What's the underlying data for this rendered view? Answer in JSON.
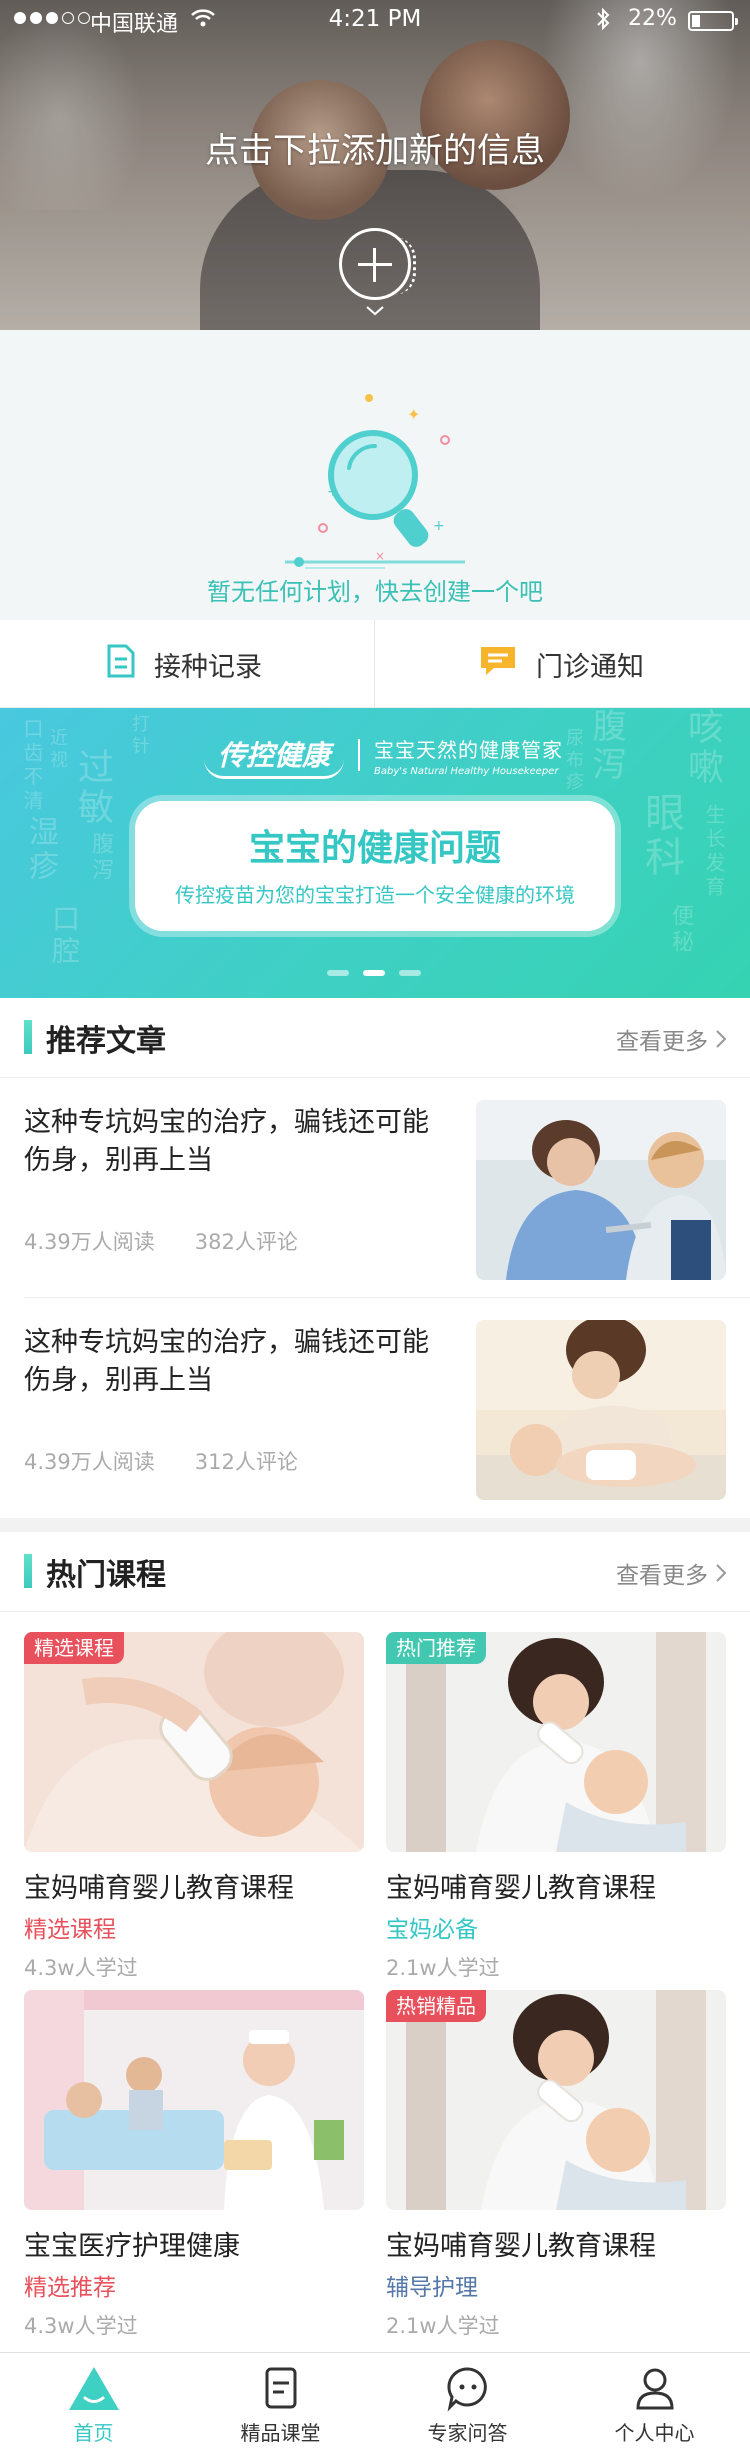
{
  "status_bar": {
    "carrier": "中国联通",
    "time": "4:21 PM",
    "battery": "22%",
    "battery_level": 0.22
  },
  "hero": {
    "title": "点击下拉添加新的信息"
  },
  "empty_plan": {
    "message": "暂无任何计划，快去创建一个吧"
  },
  "quick_actions": [
    {
      "label": "接种记录",
      "icon": "document-icon"
    },
    {
      "label": "门诊通知",
      "icon": "chat-bubble-icon"
    }
  ],
  "banner": {
    "brand_logo": "传控健康",
    "brand_cn": "宝宝天然的健康管家",
    "brand_en": "Baby's Natural Healthy Housekeeper",
    "title": "宝宝的健康问题",
    "subtitle": "传控疫苗为您的宝宝打造一个安全健康的环境",
    "background_words": [
      "口齿不清",
      "过敏",
      "湿疹",
      "口腔",
      "腹泻",
      "咳嗽",
      "眼科",
      "生长发育",
      "便秘",
      "尿布疹",
      "打针",
      "近视",
      "腹泻"
    ],
    "dots": 3,
    "active_dot": 1
  },
  "articles_section": {
    "title": "推荐文章",
    "more": "查看更多",
    "items": [
      {
        "title": "这种专坑妈宝的治疗，骗钱还可能伤身，别再上当",
        "reads": "4.39万人阅读",
        "comments": "382人评论"
      },
      {
        "title": "这种专坑妈宝的治疗，骗钱还可能伤身，别再上当",
        "reads": "4.39万人阅读",
        "comments": "312人评论"
      }
    ]
  },
  "courses_section": {
    "title": "热门课程",
    "more": "查看更多",
    "items": [
      {
        "badge": "精选课程",
        "badge_color": "#e8505b",
        "title": "宝妈哺育婴儿教育课程",
        "tag": "精选课程",
        "tag_color": "#e8505b",
        "learners": "4.3w人学过"
      },
      {
        "badge": "热门推荐",
        "badge_color": "#42c8b0",
        "title": "宝妈哺育婴儿教育课程",
        "tag": "宝妈必备",
        "tag_color": "#35c7c4",
        "learners": "2.1w人学过"
      },
      {
        "badge": "",
        "badge_color": "",
        "title": "宝宝医疗护理健康",
        "tag": "精选推荐",
        "tag_color": "#e8505b",
        "learners": "4.3w人学过"
      },
      {
        "badge": "热销精品",
        "badge_color": "#e8505b",
        "title": "宝妈哺育婴儿教育课程",
        "tag": "辅导护理",
        "tag_color": "#5577aa",
        "learners": "2.1w人学过"
      }
    ]
  },
  "tabs": [
    {
      "label": "首页",
      "icon": "home-icon",
      "active": true
    },
    {
      "label": "精品课堂",
      "icon": "notes-icon",
      "active": false
    },
    {
      "label": "专家问答",
      "icon": "chat-icon",
      "active": false
    },
    {
      "label": "个人中心",
      "icon": "user-icon",
      "active": false
    }
  ],
  "colors": {
    "accent": "#35c7c4",
    "red": "#e8505b",
    "banner_start": "#49c8df",
    "banner_end": "#35d3b2"
  }
}
